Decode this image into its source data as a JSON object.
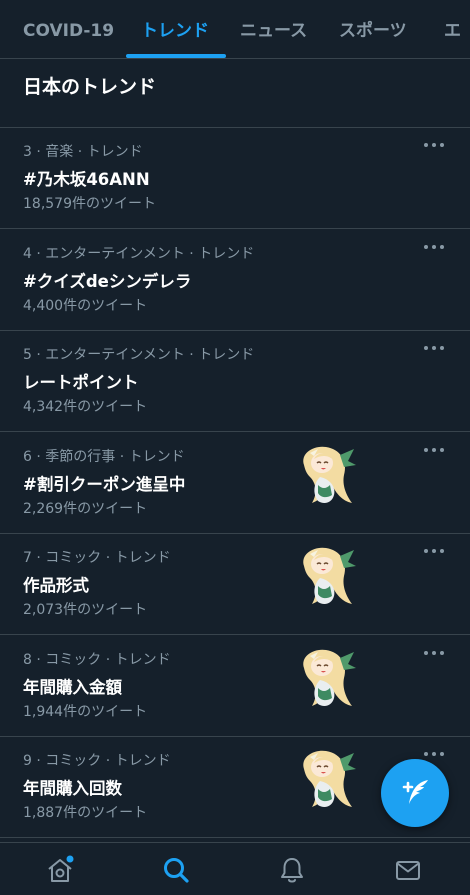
{
  "tabs": [
    {
      "label": "COVID-19",
      "active": false
    },
    {
      "label": "トレンド",
      "active": true
    },
    {
      "label": "ニュース",
      "active": false
    },
    {
      "label": "スポーツ",
      "active": false
    },
    {
      "label": "エ",
      "active": false
    }
  ],
  "section": {
    "title": "日本のトレンド"
  },
  "trends": [
    {
      "meta": "3 · 音楽 · トレンド",
      "name": "#乃木坂46ANN",
      "count": "18,579件のツイート",
      "has_thumb": false
    },
    {
      "meta": "4 · エンターテインメント · トレンド",
      "name": "#クイズdeシンデレラ",
      "count": "4,400件のツイート",
      "has_thumb": false
    },
    {
      "meta": "5 · エンターテインメント · トレンド",
      "name": "レートポイント",
      "count": "4,342件のツイート",
      "has_thumb": false
    },
    {
      "meta": "6 · 季節の行事 · トレンド",
      "name": "#割引クーポン進呈中",
      "count": "2,269件のツイート",
      "has_thumb": true
    },
    {
      "meta": "7 · コミック · トレンド",
      "name": "作品形式",
      "count": "2,073件のツイート",
      "has_thumb": true
    },
    {
      "meta": "8 · コミック · トレンド",
      "name": "年間購入金額",
      "count": "1,944件のツイート",
      "has_thumb": true
    },
    {
      "meta": "9 · コミック · トレンド",
      "name": "年間購入回数",
      "count": "1,887件のツイート",
      "has_thumb": true
    }
  ],
  "icons": {
    "more": "more-dots-icon",
    "compose": "compose-tweet-icon",
    "nav": [
      "home-icon",
      "search-icon",
      "notifications-icon",
      "messages-icon"
    ]
  },
  "colors": {
    "background": "#15202b",
    "accent": "#1da1f2",
    "muted": "#8899a6",
    "border": "#38444d"
  }
}
